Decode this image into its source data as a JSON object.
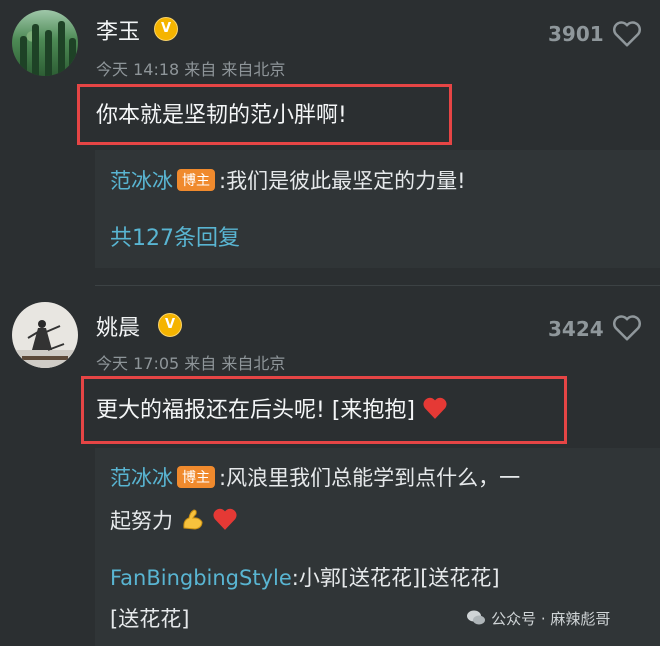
{
  "comments": [
    {
      "username": "李玉",
      "badge": "V",
      "time": "今天 14:18 来自 来自北京",
      "likes": "3901",
      "text": "你本就是坚韧的范小胖啊!",
      "reply_name": "范冰冰",
      "reply_tag": "博主",
      "reply_text": ":我们是彼此最坚定的力量!",
      "more_replies": "共127条回复"
    },
    {
      "username": "姚晨",
      "badge": "V",
      "time": "今天 17:05 来自 来自北京",
      "likes": "3424",
      "text": "更大的福报还在后头呢! [来抱抱]",
      "reply_name": "范冰冰",
      "reply_tag": "博主",
      "reply_text_line1": ":风浪里我们总能学到点什么，一",
      "reply_text_line2": "起努力",
      "reply2_name": "FanBingbingStyle",
      "reply2_text_line1": ":小郭[送花花][送花花]",
      "reply2_text_line2": "[送花花]"
    }
  ],
  "watermark": "公众号 · 麻辣彪哥",
  "colors": {
    "accent": "#59b5d2",
    "highlight": "#e64545",
    "tag": "#f08a2d",
    "badge": "#f5b400"
  }
}
